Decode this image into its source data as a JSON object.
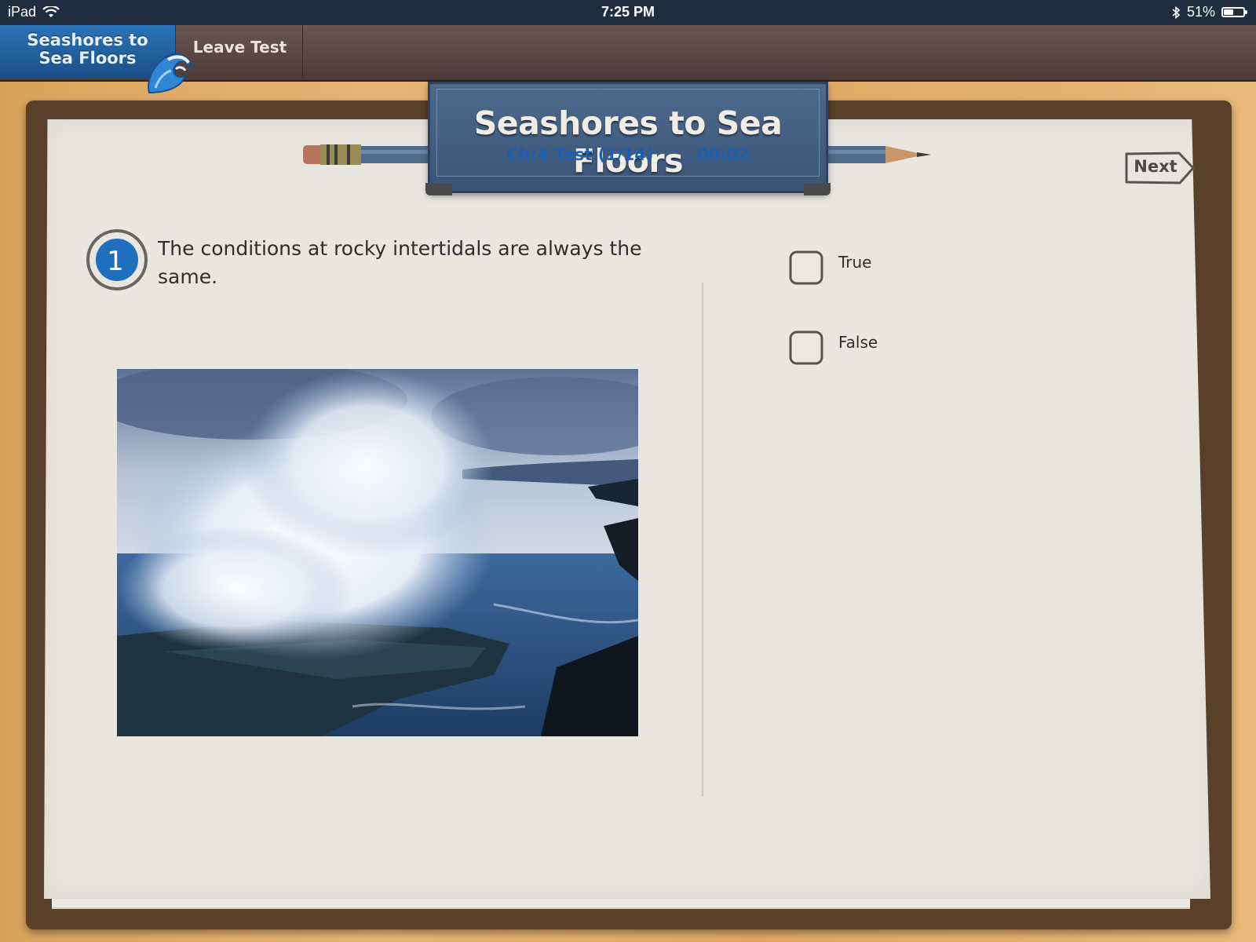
{
  "status_bar": {
    "device": "iPad",
    "time": "7:25 PM",
    "battery": "51%",
    "battery_level": 0.51,
    "icons": [
      "wifi-icon",
      "bluetooth-icon",
      "battery-icon"
    ]
  },
  "nav": {
    "home_tab": "Seashores to Sea Floors",
    "leave_test": "Leave Test"
  },
  "plaque": {
    "title": "Seashores to Sea Floors",
    "test_label": "Ch:4 Test (1/14)",
    "timer": "00:02"
  },
  "next_label": "Next",
  "question": {
    "number": "1",
    "text": "The conditions at rocky intertidals are always the same."
  },
  "answers": [
    {
      "label": "True",
      "checked": false
    },
    {
      "label": "False",
      "checked": false
    }
  ],
  "colors": {
    "accent_blue": "#1c5fb3",
    "nav_brown": "#5a4644",
    "paper": "#e9e6df"
  }
}
